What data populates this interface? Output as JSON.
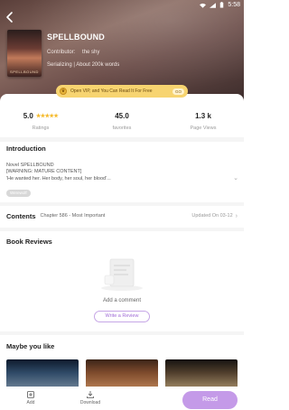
{
  "status_bar": {
    "time": "5:58"
  },
  "book": {
    "title": "SPELLBOUND",
    "contributor_label": "Contributor:",
    "contributor": "the shy",
    "serial_info": "Serializing | About 200k words",
    "cover_text": "SPELLBOUND"
  },
  "vip_banner": {
    "text": "Open VIP, and You Can Read It For Free",
    "action": "GO"
  },
  "stats": [
    {
      "value": "5.0",
      "label": "Ratings",
      "stars": 5
    },
    {
      "value": "45.0",
      "label": "favorites"
    },
    {
      "value": "1.3 k",
      "label": "Page Views"
    }
  ],
  "introduction": {
    "title": "Introduction",
    "lines": [
      "Novel SPELLBOUND",
      "[WARNING: MATURE CONTENT]",
      "'He wanted her. Her body, her soul, her blood'..."
    ],
    "tag": "Werewolf"
  },
  "contents": {
    "title": "Contents",
    "chapter": "Chapter 586 - Most Important",
    "updated": "Updated On 03-12"
  },
  "reviews": {
    "title": "Book Reviews",
    "empty_text": "Add a comment",
    "write_button": "Write a Review"
  },
  "maybe_like": {
    "title": "Maybe you like"
  },
  "bottom_bar": {
    "add": "Add",
    "download": "Download",
    "read": "Read"
  },
  "colors": {
    "accent": "#c49ae8",
    "star": "#f5b928",
    "vip": "#f7d470"
  }
}
